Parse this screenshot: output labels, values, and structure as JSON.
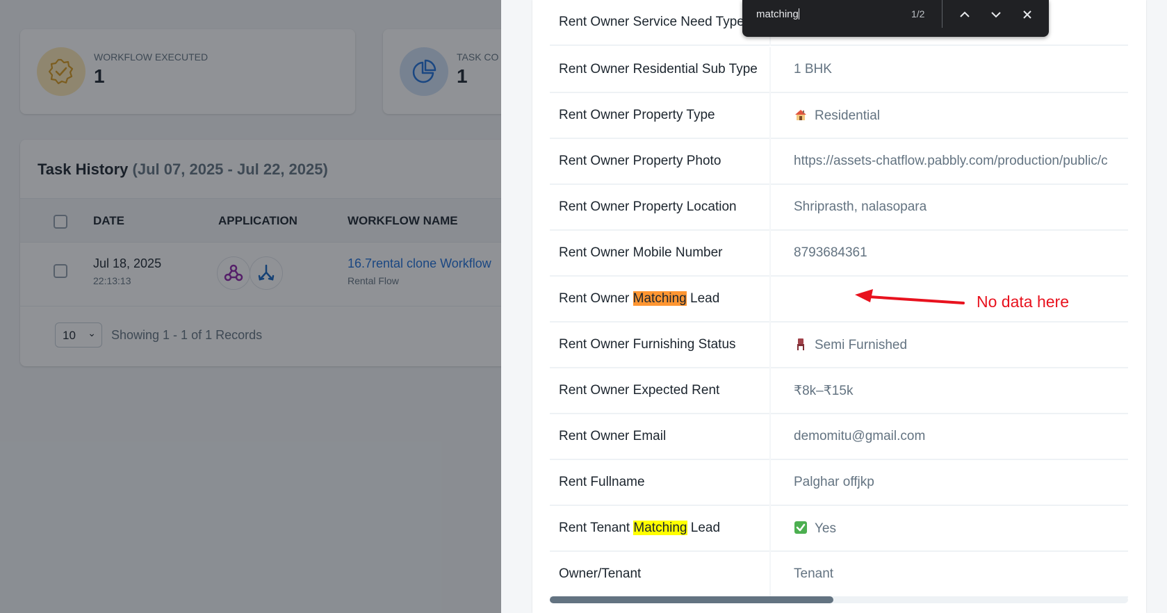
{
  "dashboard": {
    "stat_cards": [
      {
        "label": "WORKFLOW EXECUTED",
        "value": "1",
        "icon": "verified-badge-icon"
      },
      {
        "label": "TASK CO",
        "value": "1",
        "icon": "pie-chart-icon"
      }
    ],
    "task_history": {
      "title": "Task History",
      "range": "(Jul 07, 2025 - Jul 22, 2025)",
      "columns": [
        "DATE",
        "APPLICATION",
        "WORKFLOW NAME"
      ],
      "rows": [
        {
          "date": "Jul 18, 2025",
          "time": "22:13:13",
          "workflow_name": "16.7rental clone Workflow",
          "workflow_sub": "Rental Flow"
        }
      ],
      "per_page": "10",
      "showing": "Showing 1 - 1 of 1 Records"
    }
  },
  "drawer": {
    "fields": [
      {
        "label": "Rent Owner Service Need Type",
        "value": ""
      },
      {
        "label": "Rent Owner Residential Sub Type",
        "value": "1 BHK"
      },
      {
        "label": "Rent Owner Property Type",
        "value": "Residential",
        "emoji": "house-icon"
      },
      {
        "label": "Rent Owner Property Photo",
        "value": "https://assets-chatflow.pabbly.com/production/public/c"
      },
      {
        "label": "Rent Owner Property Location",
        "value": "Shriprasth, nalasopara"
      },
      {
        "label": "Rent Owner Mobile Number",
        "value": "8793684361"
      },
      {
        "label_pre": "Rent Owner ",
        "label_match": "Matching",
        "label_post": " Lead",
        "value": "",
        "match_color": "#ff9632"
      },
      {
        "label": "Rent Owner Furnishing Status",
        "value": "Semi Furnished",
        "emoji": "chair-icon"
      },
      {
        "label": "Rent Owner Expected Rent",
        "value": "₹8k–₹15k"
      },
      {
        "label": "Rent Owner Email",
        "value": "demomitu@gmail.com"
      },
      {
        "label": "Rent Fullname",
        "value": "Palghar offjkp"
      },
      {
        "label_pre": "Rent Tenant ",
        "label_match": "Matching",
        "label_post": " Lead",
        "value": "Yes",
        "emoji": "check-mark-icon",
        "match_color": "#ffff00"
      },
      {
        "label": "Owner/Tenant",
        "value": "Tenant"
      }
    ],
    "horizontal_scroll_fraction": 0.49
  },
  "annotation": {
    "text": "No data here",
    "color": "#e8121e"
  },
  "find_bar": {
    "query": "matching",
    "count": "1/2"
  },
  "colors": {
    "accent_blue": "#1e6fd9",
    "gold": "#fde9b4",
    "text_secondary": "#637381"
  }
}
